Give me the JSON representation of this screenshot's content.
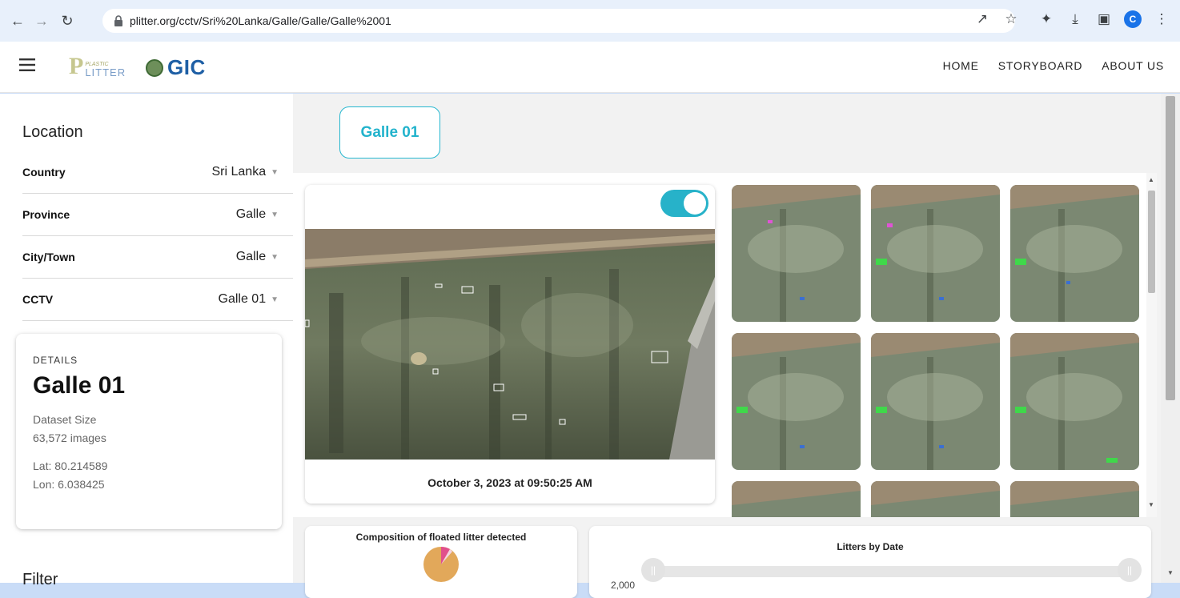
{
  "browser": {
    "url": "plitter.org/cctv/Sri%20Lanka/Galle/Galle/Galle%2001",
    "avatar_letter": "C"
  },
  "header": {
    "logo_plitter_tag": "PLASTIC",
    "logo_plitter_word": "LITTER",
    "logo_gic": "GIC",
    "nav": [
      "HOME",
      "STORYBOARD",
      "ABOUT US"
    ]
  },
  "sidebar": {
    "location_title": "Location",
    "fields": [
      {
        "label": "Country",
        "value": "Sri Lanka"
      },
      {
        "label": "Province",
        "value": "Galle"
      },
      {
        "label": "City/Town",
        "value": "Galle"
      },
      {
        "label": "CCTV",
        "value": "Galle 01"
      }
    ],
    "details": {
      "overline": "DETAILS",
      "title": "Galle 01",
      "dataset_label": "Dataset Size",
      "dataset_value": "63,572 images",
      "lat": "Lat: 80.214589",
      "lon": "Lon: 6.038425"
    },
    "filter_title": "Filter"
  },
  "main": {
    "camera_chip": "Galle 01",
    "toggle_on": true,
    "timestamp": "October 3, 2023 at 09:50:25 AM",
    "composition_title": "Composition of floated litter detected",
    "litters_by_date_title": "Litters by Date",
    "axis_tick": "2,000"
  },
  "colors": {
    "accent": "#27b2c9",
    "pie_main": "#e2a85a",
    "pie_slice": "#e14f8c"
  }
}
